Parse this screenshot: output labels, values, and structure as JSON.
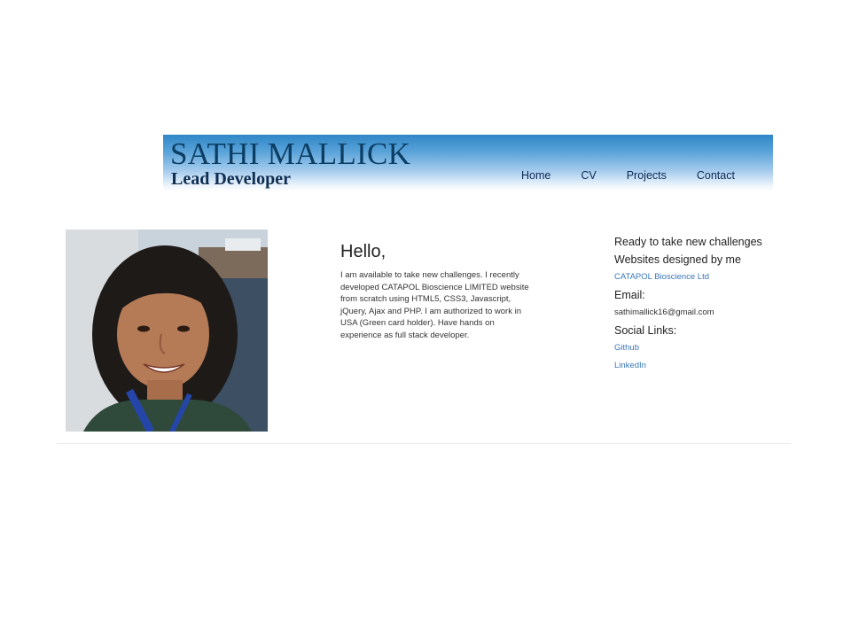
{
  "header": {
    "name": "SATHI MALLICK",
    "role": "Lead Developer",
    "gradient_top": "#2f86c7",
    "gradient_bottom": "#ffffff"
  },
  "nav": {
    "items": [
      {
        "label": "Home"
      },
      {
        "label": "CV"
      },
      {
        "label": "Projects"
      },
      {
        "label": "Contact"
      }
    ]
  },
  "intro": {
    "heading": "Hello,",
    "body": "I am available to take new challenges. I recently developed CATAPOL Bioscience LIMITED website from scratch using HTML5, CSS3, Javascript, jQuery, Ajax and PHP. I am authorized to work in USA (Green card holder). Have hands on experience as full stack developer."
  },
  "side": {
    "ready_heading": "Ready to take new challenges",
    "websites_heading": "Websites designed by me",
    "website_link": "CATAPOL Bioscience Ltd",
    "email_heading": "Email:",
    "email_value": "sathimallick16@gmail.com",
    "social_heading": "Social Links:",
    "social_links": [
      {
        "label": "Github"
      },
      {
        "label": "LinkedIn"
      }
    ],
    "link_color": "#3a76b8"
  },
  "photo": {
    "icon": "profile-photo"
  }
}
